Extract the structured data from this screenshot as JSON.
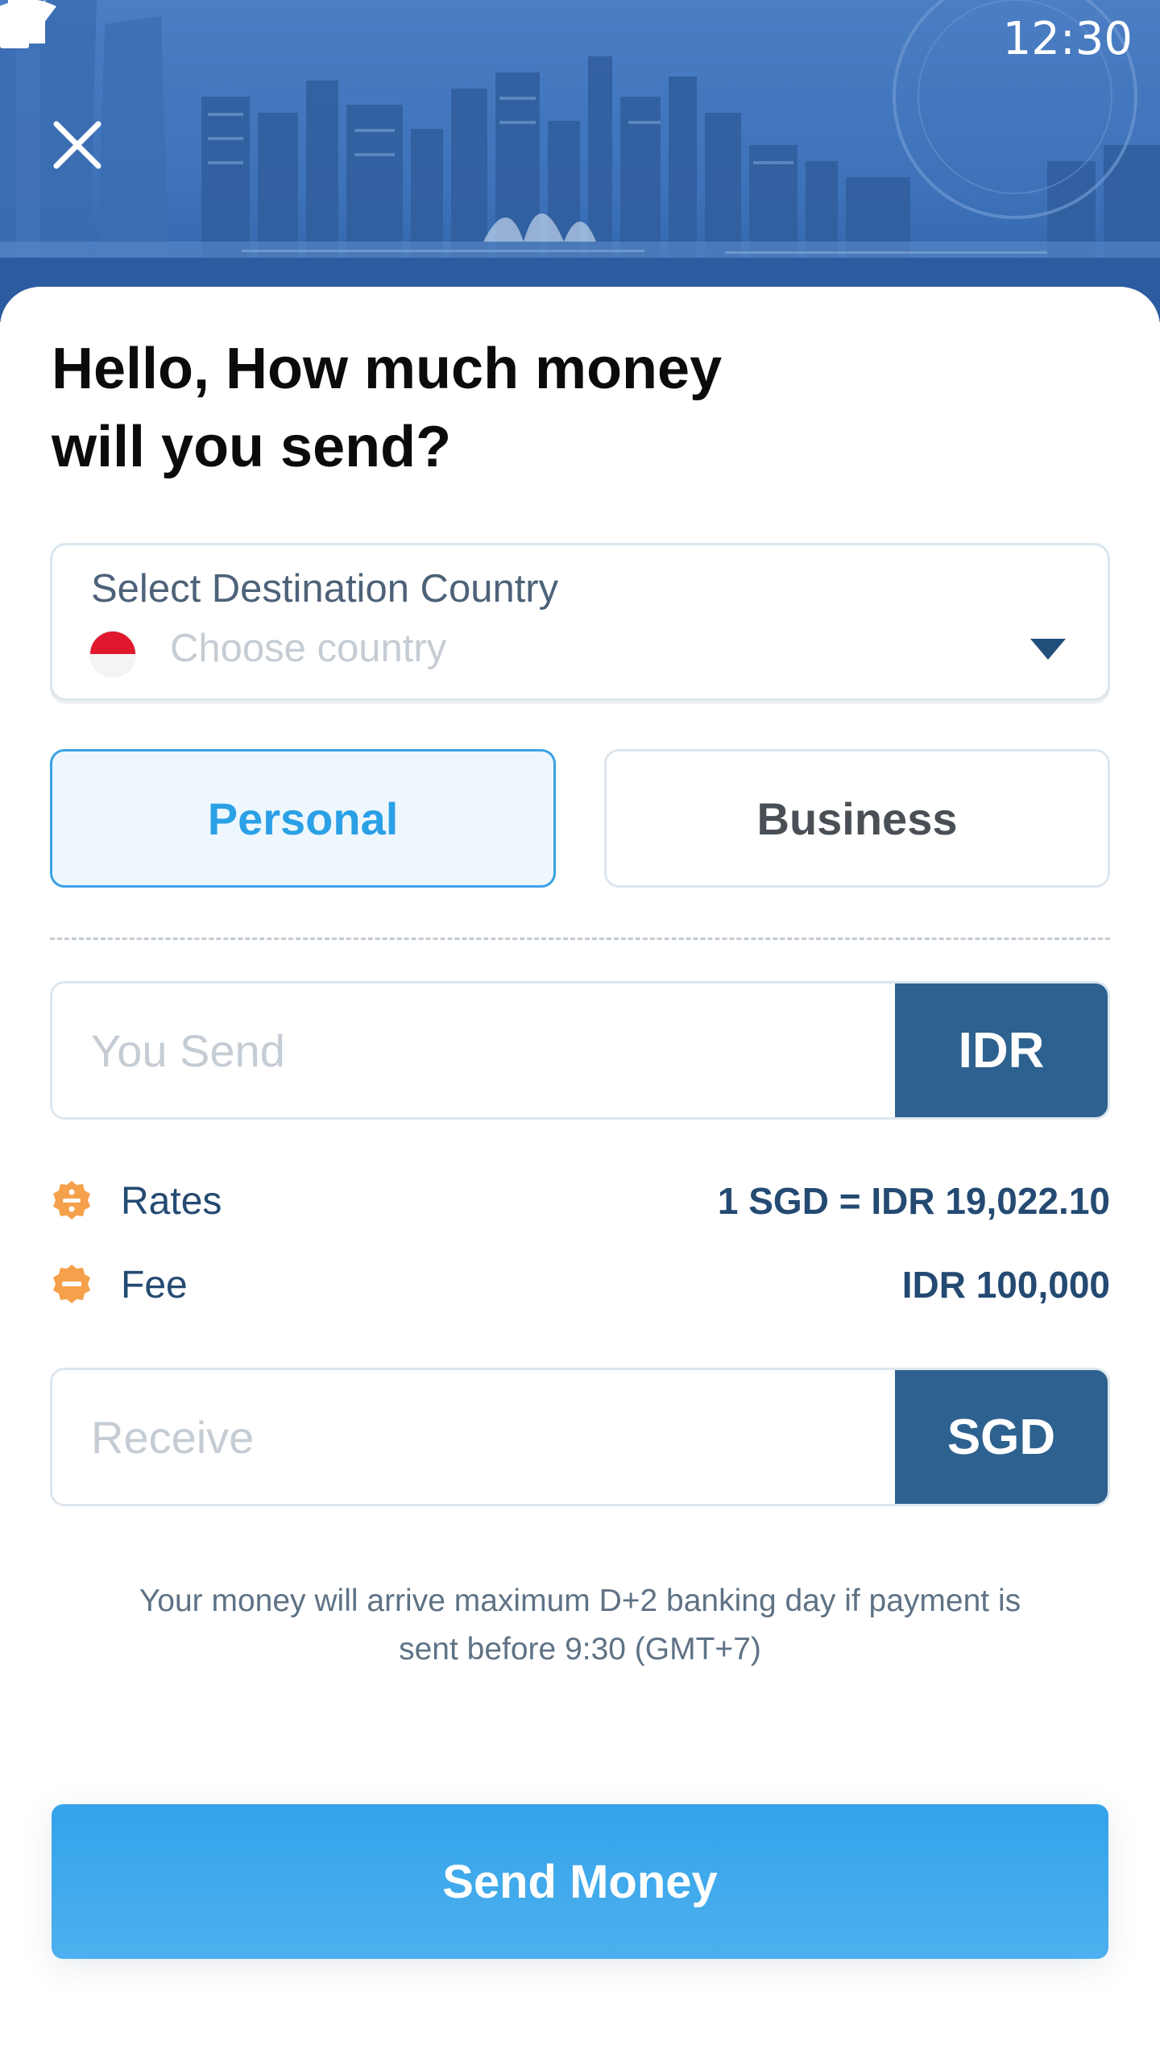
{
  "status_bar": {
    "time": "12:30",
    "icons": [
      "wifi-icon",
      "cellular-signal-icon",
      "battery-icon"
    ]
  },
  "header": {
    "close_icon": "close-icon",
    "background": "city-skyline-image"
  },
  "title": "Hello, How much money\nwill you send?",
  "country_select": {
    "label": "Select Destination Country",
    "placeholder": "Choose country",
    "flag": "indonesia-flag",
    "caret_icon": "caret-down-icon"
  },
  "type_toggle": {
    "personal": "Personal",
    "business": "Business",
    "selected": "Personal"
  },
  "send_amount": {
    "placeholder": "You Send",
    "currency": "IDR"
  },
  "rates": {
    "label": "Rates",
    "value": "1 SGD = IDR 19,022.10",
    "icon": "divide-badge-icon"
  },
  "fee": {
    "label": "Fee",
    "value": "IDR 100,000",
    "icon": "minus-badge-icon"
  },
  "receive_amount": {
    "placeholder": "Receive",
    "currency": "SGD"
  },
  "note": "Your money will arrive maximum D+2 banking day if payment is sent before 9:30 (GMT+7)",
  "send_button": "Send Money",
  "colors": {
    "primary_blue": "#33a3ea",
    "navy": "#2d618f",
    "accent_orange": "#f5a04a"
  }
}
